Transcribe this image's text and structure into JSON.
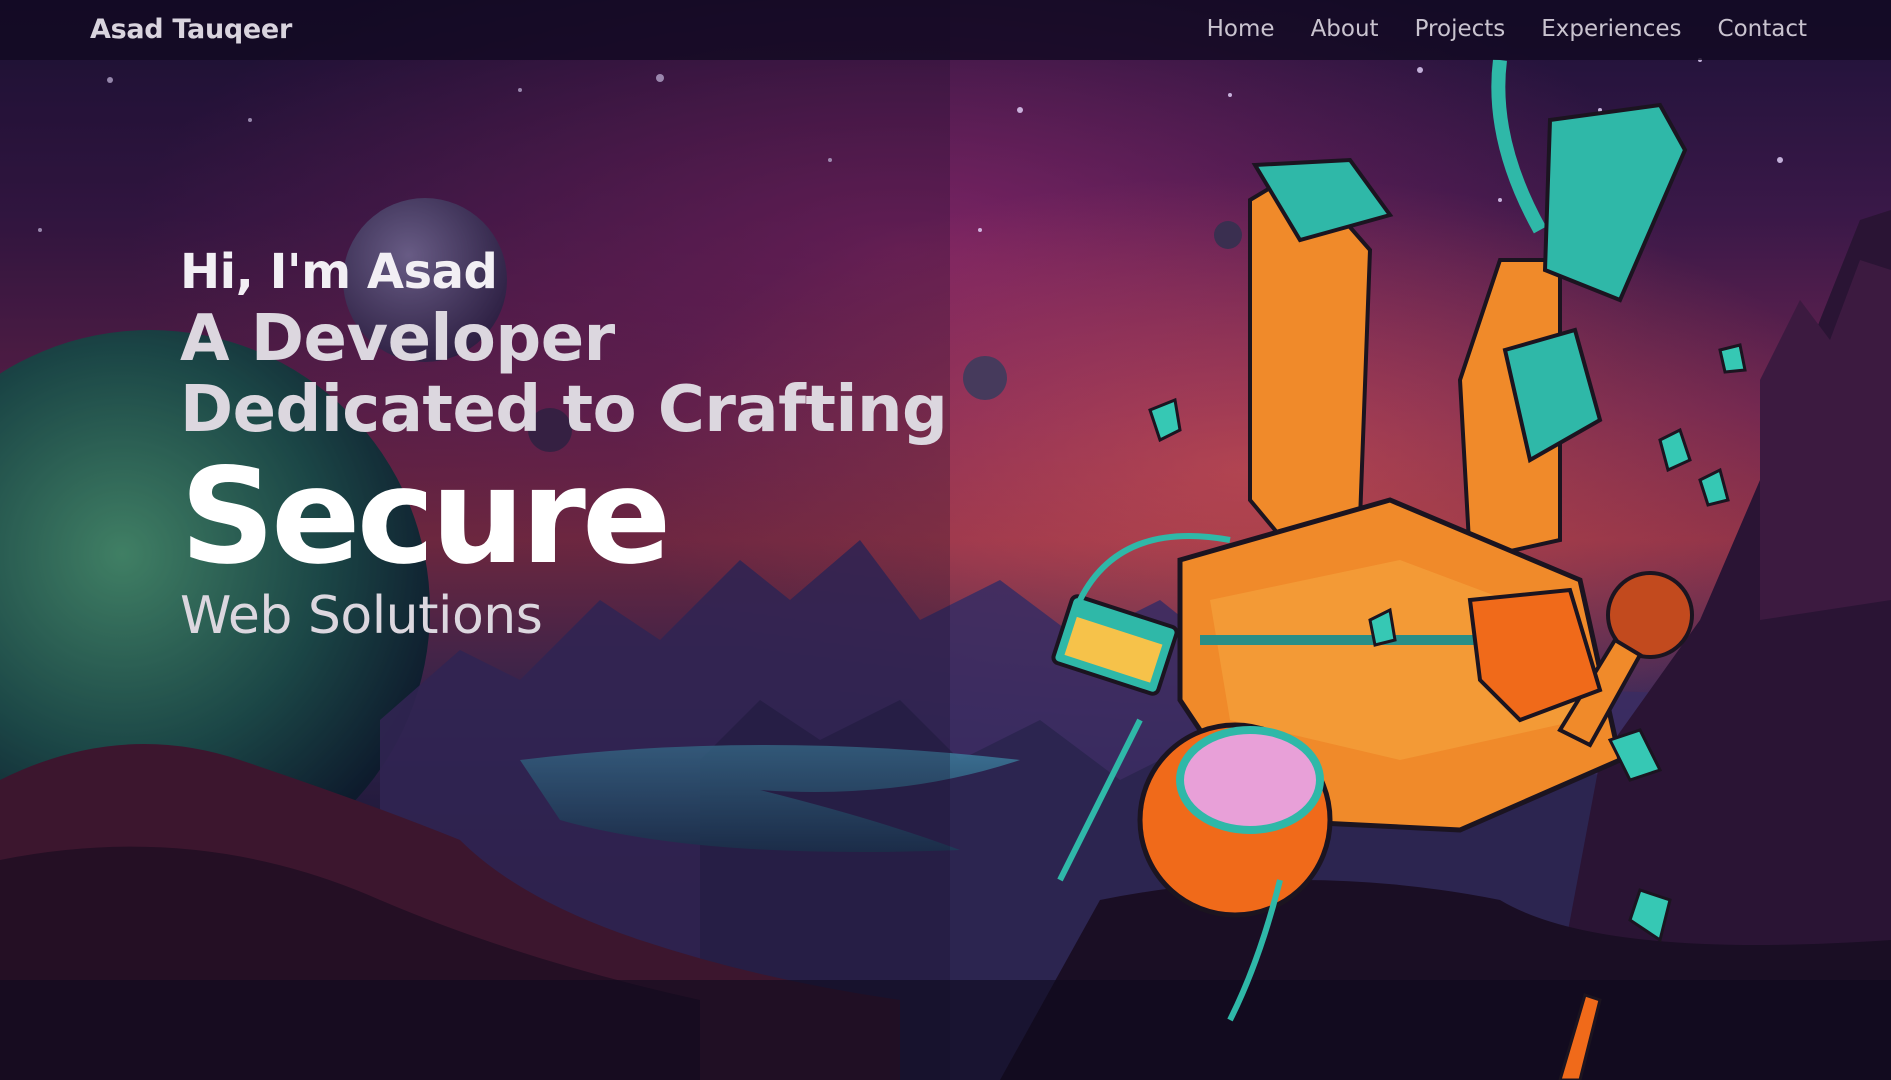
{
  "site": {
    "brand": "Asad Tauqeer"
  },
  "nav": {
    "items": [
      {
        "label": "Home"
      },
      {
        "label": "About"
      },
      {
        "label": "Projects"
      },
      {
        "label": "Experiences"
      },
      {
        "label": "Contact"
      }
    ]
  },
  "hero": {
    "greeting": "Hi, I'm Asad",
    "line_1": "A Developer",
    "line_2": "Dedicated to Crafting",
    "highlight": "Secure",
    "line_3": "Web Solutions"
  },
  "colors": {
    "nav_background": "#120a22",
    "text_primary": "#ffffff",
    "text_secondary": "#dcd7df",
    "sky_purple": "#6a2450",
    "astronaut_orange": "#f08a2a",
    "astronaut_teal": "#2fb8a8"
  }
}
